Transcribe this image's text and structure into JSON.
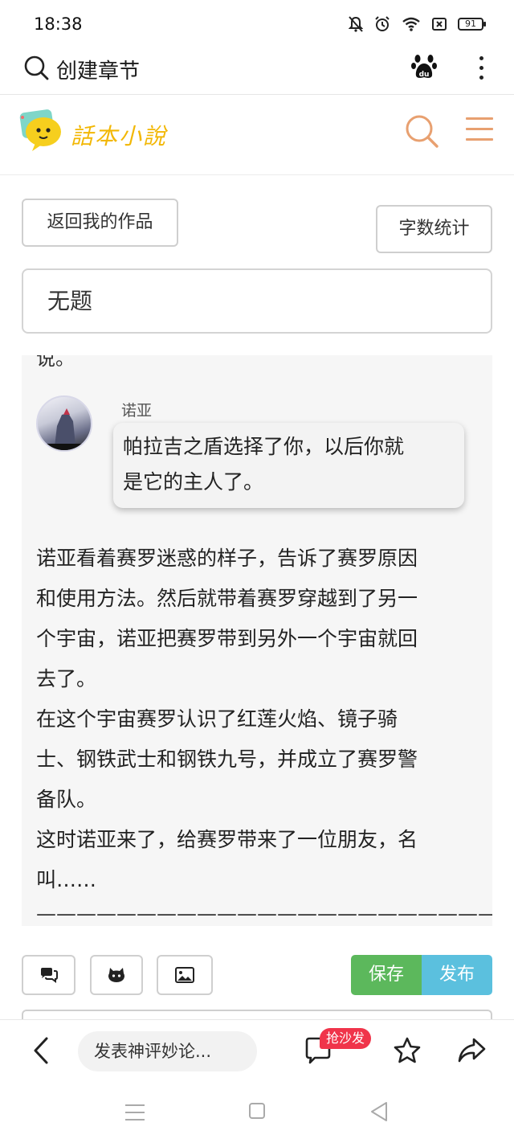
{
  "status_bar": {
    "time": "18:38",
    "battery": "91",
    "icons": [
      "bell-off-icon",
      "alarm-icon",
      "wifi-icon",
      "sim-icon",
      "battery-icon"
    ]
  },
  "browser": {
    "search_text": "创建章节",
    "icons": [
      "search-icon",
      "baidu-paw-icon",
      "more-vertical-icon"
    ]
  },
  "site": {
    "logo_text": "話本小說",
    "accent_color": "#e8a070",
    "logo_color": "#f2b705"
  },
  "editor": {
    "back_button": "返回我的作品",
    "stats_button": "字数统计",
    "title_value": "无题",
    "cut_top_text": "说。",
    "dialog": {
      "speaker": "诺亚",
      "lines": [
        "帕拉吉之盾选择了你，以后你就",
        "是它的主人了。"
      ]
    },
    "body_lines": [
      "诺亚看着赛罗迷惑的样子，告诉了赛罗原因",
      "和使用方法。然后就带着赛罗穿越到了另一",
      "个宇宙，诺亚把赛罗带到另外一个宇宙就回",
      "去了。",
      "在这个宇宙赛罗认识了红莲火焰、镜子骑",
      "士、钢铁武士和钢铁九号，并成立了赛罗警",
      "备队。",
      "这时诺亚来了，给赛罗带来了一位朋友，名",
      "叫……"
    ],
    "divider": "——————————————————————————"
  },
  "toolbar": {
    "save_label": "保存",
    "publish_label": "发布",
    "save_color": "#5cb85c",
    "publish_color": "#5bc0de"
  },
  "bottom_bar": {
    "comment_placeholder": "发表神评妙论...",
    "sofa_badge": "抢沙发"
  }
}
